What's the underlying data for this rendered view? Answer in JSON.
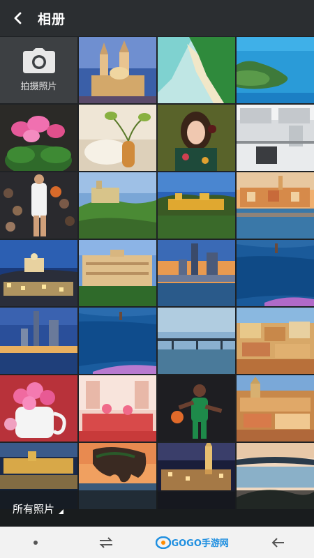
{
  "header": {
    "title": "相册",
    "back_icon": "arrow-left-icon"
  },
  "camera_tile": {
    "label": "拍摄照片",
    "icon": "camera-icon"
  },
  "album_bar": {
    "label": "所有照片"
  },
  "navbar": {
    "watermark": "GOGO手游网"
  },
  "colors": {
    "topbar": "#2b2e31",
    "grid_bg": "#1f2225",
    "navbar": "#f2f2f2"
  }
}
